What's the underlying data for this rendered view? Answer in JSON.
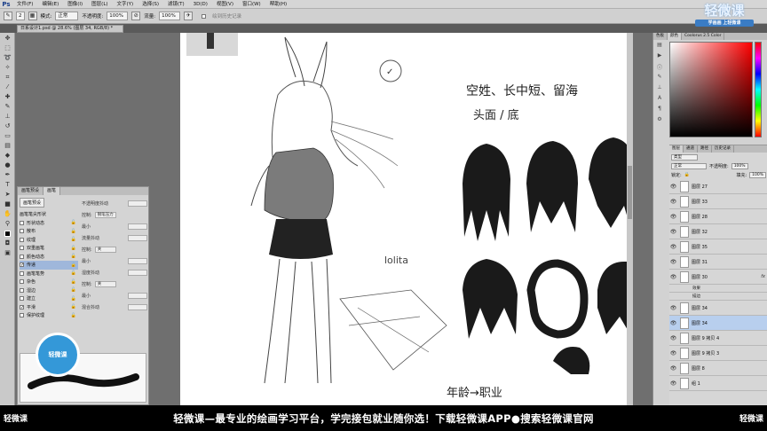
{
  "app": {
    "logo": "Ps"
  },
  "menu": {
    "items": [
      "文件(F)",
      "编辑(E)",
      "图像(I)",
      "图层(L)",
      "文字(Y)",
      "选择(S)",
      "滤镜(T)",
      "3D(D)",
      "视图(V)",
      "窗口(W)",
      "帮助(H)"
    ]
  },
  "options": {
    "size_value": "2",
    "mode_label": "模式:",
    "mode_value": "正常",
    "opacity_label": "不透明度:",
    "opacity_value": "100%",
    "flow_label": "流量:",
    "flow_value": "100%",
    "history_label": "绘到历史记录"
  },
  "document": {
    "tab_title": "日系设计1.psd @ 28.6% (图层 34, RGB/8) *"
  },
  "brush_panel": {
    "tabs": [
      "画笔预设",
      "画笔"
    ],
    "preset_button": "画笔预设",
    "left_items": [
      {
        "label": "画笔笔尖形状",
        "checked": false
      },
      {
        "label": "形状动态",
        "checked": false
      },
      {
        "label": "散布",
        "checked": false
      },
      {
        "label": "纹理",
        "checked": false
      },
      {
        "label": "双重画笔",
        "checked": false
      },
      {
        "label": "颜色动态",
        "checked": false
      },
      {
        "label": "传递",
        "checked": true
      },
      {
        "label": "画笔笔势",
        "checked": false
      },
      {
        "label": "杂色",
        "checked": false
      },
      {
        "label": "湿边",
        "checked": false
      },
      {
        "label": "建立",
        "checked": false
      },
      {
        "label": "平滑",
        "checked": true
      },
      {
        "label": "保护纹理",
        "checked": false
      }
    ],
    "right": {
      "opacity_jitter": "不透明度抖动",
      "control_label": "控制:",
      "control_value_1": "钢笔压力",
      "minimum": "最小",
      "flow_jitter": "流量抖动",
      "control_value_2": "关",
      "wetness_jitter": "湿度抖动",
      "control_value_3": "关",
      "mix_jitter": "混合抖动"
    }
  },
  "color_panel": {
    "tabs": [
      "色板",
      "颜色",
      "Coolorus 2.5 Color"
    ]
  },
  "layers_panel": {
    "tabs": [
      "图层",
      "通道",
      "路径",
      "历史记录"
    ],
    "kind_label": "类型",
    "blend_mode": "正常",
    "opacity_label": "不透明度:",
    "opacity_value": "100%",
    "lock_label": "锁定:",
    "fill_label": "填充:",
    "fill_value": "100%",
    "layers": [
      {
        "name": "图层 27",
        "selected": false,
        "fx": false
      },
      {
        "name": "图层 33",
        "selected": false,
        "fx": false
      },
      {
        "name": "图层 28",
        "selected": false,
        "fx": false
      },
      {
        "name": "图层 32",
        "selected": false,
        "fx": false
      },
      {
        "name": "图层 35",
        "selected": false,
        "fx": false
      },
      {
        "name": "图层 31",
        "selected": false,
        "fx": false
      },
      {
        "name": "图层 30",
        "selected": false,
        "fx": true
      },
      {
        "name": "效果",
        "selected": false,
        "sub": true
      },
      {
        "name": "描边",
        "selected": false,
        "sub": true
      },
      {
        "name": "图层 34",
        "selected": false,
        "fx": false
      },
      {
        "name": "图层 34",
        "selected": true,
        "fx": false
      },
      {
        "name": "图层 9 拷贝 4",
        "selected": false,
        "fx": false
      },
      {
        "name": "图层 9 拷贝 3",
        "selected": false,
        "fx": false
      },
      {
        "name": "图层 8",
        "selected": false,
        "fx": false
      },
      {
        "name": "组 1",
        "selected": false,
        "fx": false
      }
    ]
  },
  "sketch_notes": {
    "note_1": "空姓、长中短、留海",
    "note_2": "头面 / 底",
    "note_3": "lolita",
    "note_4": "年龄→职业",
    "check_mark": "✓"
  },
  "watermark": {
    "big": "轻微课",
    "small": "学画画 上轻微课"
  },
  "logo_badge": {
    "label": "轻微课"
  },
  "bottom_banner": {
    "left_logo": "轻微课",
    "text": "轻微课—最专业的绘画学习平台，学完接包就业随你选！下载轻微课APP●搜索轻微课官网",
    "right_logo": "轻微课"
  }
}
